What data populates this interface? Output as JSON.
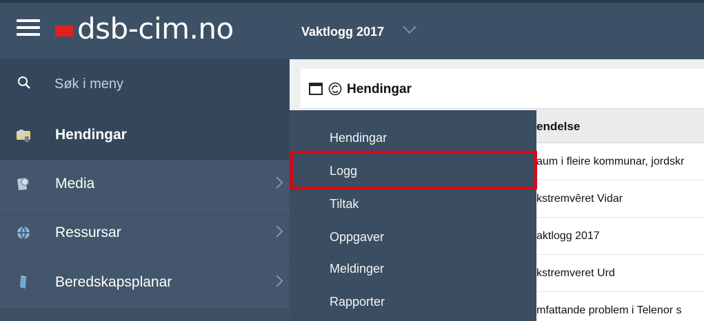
{
  "header": {
    "brand": "dsb-cim.no",
    "log_title": "Vaktlogg 2017"
  },
  "sidebar": {
    "search_placeholder": "Søk i meny",
    "items": [
      {
        "label": "Hendingar"
      },
      {
        "label": "Media"
      },
      {
        "label": "Ressursar"
      },
      {
        "label": "Beredskapsplanar"
      }
    ]
  },
  "panel": {
    "title": "Hendingar"
  },
  "table": {
    "header": "endelse",
    "rows": [
      "aum i fleire kommunar, jordskr",
      "kstremvêret Vidar",
      "aktlogg 2017",
      "kstremveret Urd",
      "mfattande problem i Telenor s"
    ]
  },
  "dropdown": {
    "items": [
      "Hendingar",
      "Logg",
      "Tiltak",
      "Oppgaver",
      "Meldinger",
      "Rapporter"
    ]
  },
  "colors": {
    "header_bg": "#3d5166",
    "sidebar_bg": "#3e5064",
    "dropdown_bg": "#3b4d60",
    "brand_red": "#e02020",
    "highlight_red": "#e4000f"
  }
}
